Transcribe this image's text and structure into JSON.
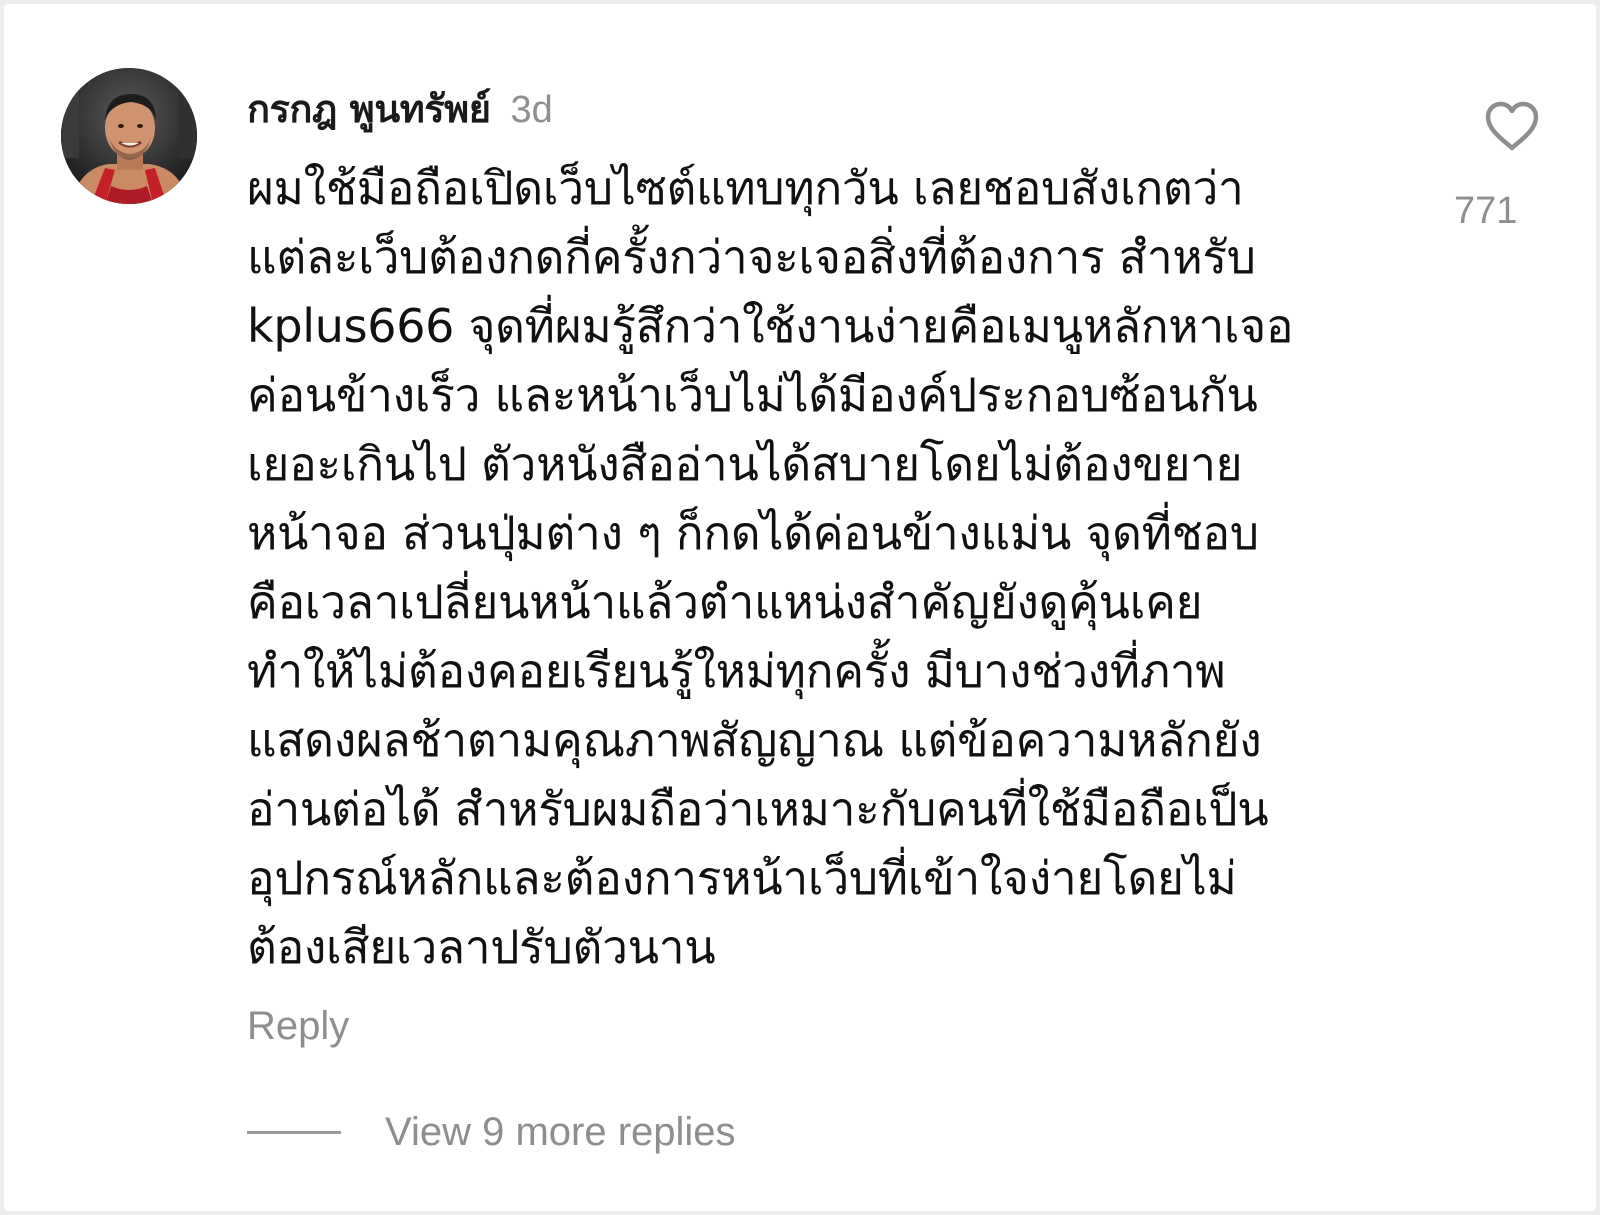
{
  "comment": {
    "author": "กรกฎ พูนทรัพย์",
    "timestamp": "3d",
    "body": "ผมใช้มือถือเปิดเว็บไซต์แทบทุกวัน เลยชอบสังเกตว่า\nแต่ละเว็บต้องกดกี่ครั้งกว่าจะเจอสิ่งที่ต้องการ สำหรับ\nkplus666 จุดที่ผมรู้สึกว่าใช้งานง่ายคือเมนูหลักหาเจอ\nค่อนข้างเร็ว และหน้าเว็บไม่ได้มีองค์ประกอบซ้อนกัน\nเยอะเกินไป ตัวหนังสืออ่านได้สบายโดยไม่ต้องขยาย\nหน้าจอ ส่วนปุ่มต่าง ๆ ก็กดได้ค่อนข้างแม่น จุดที่ชอบ\nคือเวลาเปลี่ยนหน้าแล้วตำแหน่งสำคัญยังดูคุ้นเคย\nทำให้ไม่ต้องคอยเรียนรู้ใหม่ทุกครั้ง มีบางช่วงที่ภาพ\nแสดงผลช้าตามคุณภาพสัญญาณ แต่ข้อความหลักยัง\nอ่านต่อได้ สำหรับผมถือว่าเหมาะกับคนที่ใช้มือถือเป็น\nอุปกรณ์หลักและต้องการหน้าเว็บที่เข้าใจง่ายโดยไม่\nต้องเสียเวลาปรับตัวนาน",
    "like_icon": "heart-outline-icon",
    "like_count": "771",
    "reply_label": "Reply",
    "view_replies_label": "View 9 more replies"
  },
  "colors": {
    "background": "#ffffff",
    "text_primary": "#111111",
    "text_secondary": "#8e8e8e"
  }
}
